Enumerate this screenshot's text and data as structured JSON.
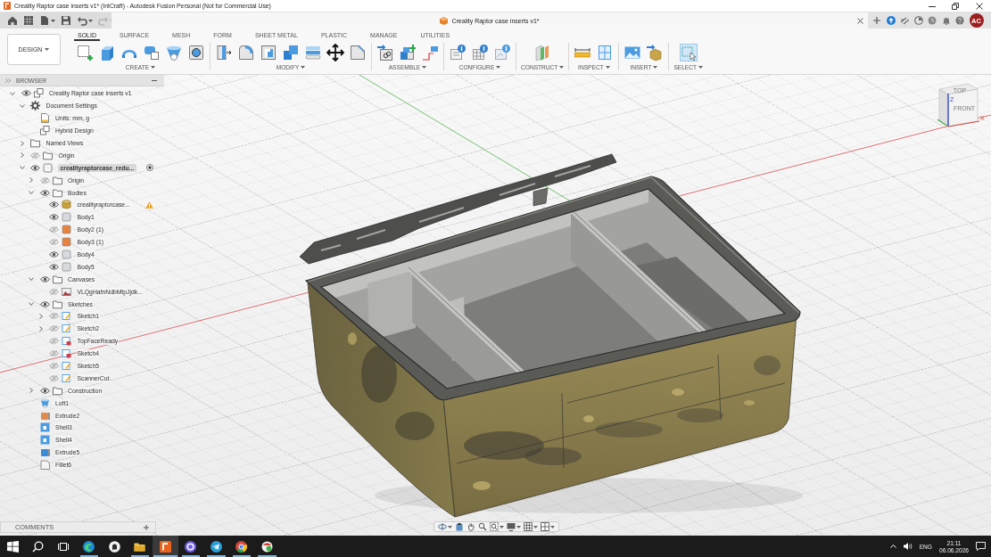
{
  "window": {
    "title": "Creality Raptor case inserts v1* (IntCraft) - Autodesk Fusion Personal (Not for Commercial Use)"
  },
  "quick_access": [
    {
      "kind": "home",
      "dropdown": false,
      "disabled": false
    },
    {
      "kind": "data-panel",
      "dropdown": false,
      "disabled": false
    },
    {
      "kind": "file",
      "dropdown": true,
      "disabled": false
    },
    {
      "kind": "save",
      "dropdown": false,
      "disabled": false
    },
    {
      "kind": "undo",
      "dropdown": true,
      "disabled": false
    },
    {
      "kind": "redo",
      "dropdown": true,
      "disabled": true
    }
  ],
  "document_tab": {
    "title": "Creality Raptor case inserts v1*"
  },
  "header_actions": [
    {
      "kind": "new-tab"
    },
    {
      "kind": "extensions"
    },
    {
      "kind": "job-status"
    },
    {
      "kind": "data"
    },
    {
      "kind": "history"
    },
    {
      "kind": "notifications"
    },
    {
      "kind": "help"
    }
  ],
  "user": {
    "initials": "AC"
  },
  "ribbon": {
    "workspace": "DESIGN",
    "tabs": [
      {
        "label": "SOLID",
        "selected": true
      },
      {
        "label": "SURFACE",
        "selected": false
      },
      {
        "label": "MESH",
        "selected": false
      },
      {
        "label": "FORM",
        "selected": false
      },
      {
        "label": "SHEET METAL",
        "selected": false
      },
      {
        "label": "PLASTIC",
        "selected": false
      },
      {
        "label": "MANAGE",
        "selected": false
      },
      {
        "label": "UTILITIES",
        "selected": false
      }
    ],
    "groups": [
      {
        "label": "CREATE",
        "tools": [
          {
            "kind": "sketch"
          },
          {
            "kind": "extrude"
          },
          {
            "kind": "revolve"
          },
          {
            "kind": "sweep"
          },
          {
            "kind": "loft"
          },
          {
            "kind": "hole"
          }
        ]
      },
      {
        "label": "MODIFY",
        "tools": [
          {
            "kind": "press-pull"
          },
          {
            "kind": "fillet"
          },
          {
            "kind": "shell"
          },
          {
            "kind": "combine"
          },
          {
            "kind": "offset-face"
          },
          {
            "kind": "move"
          },
          {
            "kind": "draft"
          }
        ]
      },
      {
        "label": "ASSEMBLE",
        "tools": [
          {
            "kind": "joint"
          },
          {
            "kind": "new-component"
          },
          {
            "kind": "as-built"
          }
        ]
      },
      {
        "label": "CONFIGURE",
        "tools": [
          {
            "kind": "configure"
          },
          {
            "kind": "table"
          },
          {
            "kind": "sheet"
          }
        ]
      },
      {
        "label": "CONSTRUCT",
        "tools": [
          {
            "kind": "plane"
          }
        ]
      },
      {
        "label": "INSPECT",
        "tools": [
          {
            "kind": "measure"
          },
          {
            "kind": "section"
          }
        ]
      },
      {
        "label": "INSERT",
        "tools": [
          {
            "kind": "canvas"
          },
          {
            "kind": "insert-mesh"
          }
        ]
      },
      {
        "label": "SELECT",
        "tools": [
          {
            "kind": "select"
          }
        ]
      }
    ]
  },
  "browser": {
    "title": "BROWSER",
    "tree": [
      {
        "label": "Creality Raptor case inserts v1",
        "kind": "document",
        "expanded": true,
        "visible": true,
        "active": false,
        "children": [
          {
            "label": "Document Settings",
            "kind": "settings",
            "expanded": true,
            "children": [
              {
                "label": "Units: mm, g",
                "kind": "units"
              },
              {
                "label": "Hybrid Design",
                "kind": "design"
              }
            ]
          },
          {
            "label": "Named Views",
            "kind": "folder",
            "expanded": false
          },
          {
            "label": "Origin",
            "kind": "folder",
            "expanded": false,
            "visible": false
          },
          {
            "label": "crealityraptorcase_redu...",
            "kind": "component",
            "expanded": true,
            "visible": true,
            "active": true,
            "children": [
              {
                "label": "Origin",
                "kind": "folder",
                "expanded": false,
                "visible": false
              },
              {
                "label": "Bodies",
                "kind": "folder",
                "expanded": true,
                "visible": true,
                "children": [
                  {
                    "label": "crealityraptorcase...",
                    "kind": "mesh-body",
                    "visible": true,
                    "warning": true
                  },
                  {
                    "label": "Body1",
                    "kind": "body",
                    "visible": true,
                    "color": "#d6d9dd"
                  },
                  {
                    "label": "Body2 (1)",
                    "kind": "body",
                    "visible": false,
                    "color": "#e5823f"
                  },
                  {
                    "label": "Body3 (1)",
                    "kind": "body",
                    "visible": false,
                    "color": "#e5823f"
                  },
                  {
                    "label": "Body4",
                    "kind": "body",
                    "visible": true,
                    "color": "#d6d9dd"
                  },
                  {
                    "label": "Body5",
                    "kind": "body",
                    "visible": true,
                    "color": "#d6d9dd"
                  }
                ]
              },
              {
                "label": "Canvases",
                "kind": "folder",
                "expanded": true,
                "visible": true,
                "children": [
                  {
                    "label": "VLQgHafnNdbMtpJjdk...",
                    "kind": "canvas",
                    "visible": false
                  }
                ]
              },
              {
                "label": "Sketches",
                "kind": "folder",
                "expanded": true,
                "visible": true,
                "children": [
                  {
                    "label": "Sketch1",
                    "kind": "sketch",
                    "expanded": false,
                    "visible": false
                  },
                  {
                    "label": "Sketch2",
                    "kind": "sketch",
                    "expanded": false,
                    "visible": false
                  },
                  {
                    "label": "TopFaceReady",
                    "kind": "sketch-flagged",
                    "visible": false
                  },
                  {
                    "label": "Sketch4",
                    "kind": "sketch-flagged",
                    "visible": false
                  },
                  {
                    "label": "Sketch5",
                    "kind": "sketch",
                    "visible": false
                  },
                  {
                    "label": "ScannerCut",
                    "kind": "sketch",
                    "visible": false
                  }
                ]
              },
              {
                "label": "Construction",
                "kind": "folder",
                "expanded": false,
                "visible": true
              },
              {
                "label": "Loft1",
                "kind": "loft"
              },
              {
                "label": "Extrude2",
                "kind": "extrude",
                "color": "#e08a4e"
              },
              {
                "label": "Shell3",
                "kind": "shell"
              },
              {
                "label": "Shell4",
                "kind": "shell"
              },
              {
                "label": "Extrude5",
                "kind": "extrude",
                "color": "#3a8ad6"
              },
              {
                "label": "Fillet6",
                "kind": "fillet"
              }
            ]
          }
        ]
      }
    ]
  },
  "view_cube": {
    "top": "TOP",
    "front": "FRONT",
    "z_axis": "Z",
    "x_axis": "X"
  },
  "navigation_bar": [
    {
      "kind": "orbit",
      "dropdown": true
    },
    {
      "kind": "look-at",
      "dropdown": false
    },
    {
      "kind": "pan",
      "dropdown": false
    },
    {
      "kind": "zoom",
      "dropdown": false
    },
    {
      "kind": "fit",
      "dropdown": true
    },
    {
      "kind": "display",
      "dropdown": true
    },
    {
      "kind": "grid",
      "dropdown": true
    },
    {
      "kind": "viewports",
      "dropdown": true
    }
  ],
  "comments": {
    "title": "COMMENTS"
  },
  "taskbar": {
    "system": [
      {
        "kind": "start"
      },
      {
        "kind": "search"
      },
      {
        "kind": "task-view"
      }
    ],
    "apps": [
      {
        "kind": "edge",
        "running": true,
        "selected": false
      },
      {
        "kind": "ghost",
        "running": false,
        "selected": false
      },
      {
        "kind": "explorer",
        "running": true,
        "selected": false
      },
      {
        "kind": "fusion",
        "running": true,
        "selected": true
      },
      {
        "kind": "chat",
        "running": true,
        "selected": false
      },
      {
        "kind": "telegram",
        "running": true,
        "selected": false
      },
      {
        "kind": "chrome",
        "running": true,
        "selected": false
      },
      {
        "kind": "game",
        "running": true,
        "selected": false
      }
    ],
    "tray": {
      "language": "ENG",
      "time": "21:11",
      "date": "06.06.2026"
    }
  }
}
